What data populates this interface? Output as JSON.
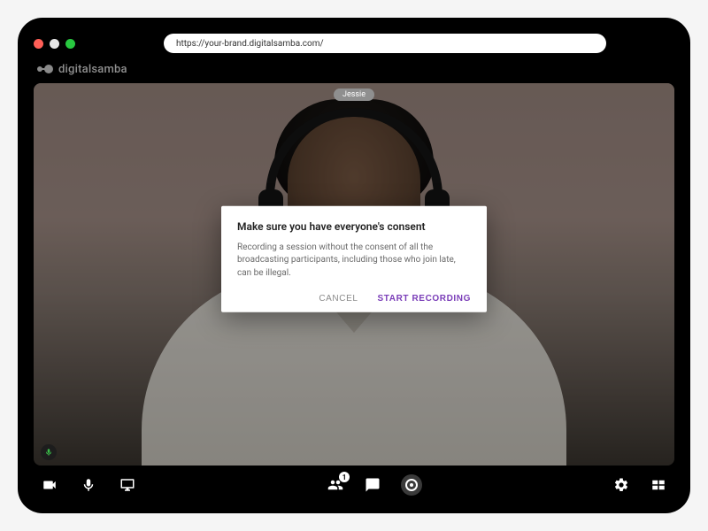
{
  "browser": {
    "url": "https://your-brand.digitalsamba.com/"
  },
  "brand": {
    "name": "digitalsamba"
  },
  "participant": {
    "name": "Jessie"
  },
  "modal": {
    "title": "Make sure you have everyone's consent",
    "body": "Recording a session without the consent of all the broadcasting participants, including those who join late, can be illegal.",
    "cancel": "CANCEL",
    "start": "START RECORDING"
  },
  "toolbar": {
    "participants_badge": "1"
  },
  "colors": {
    "accent": "#7a3db8",
    "mic_active": "#3bbf4a"
  }
}
